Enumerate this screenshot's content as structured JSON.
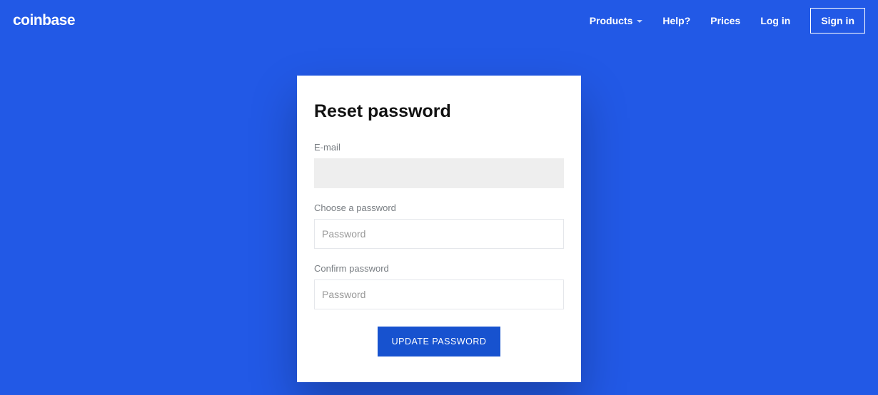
{
  "header": {
    "logo": "coinbase",
    "nav": {
      "products": "Products",
      "help": "Help?",
      "prices": "Prices",
      "login": "Log in",
      "signin": "Sign in"
    }
  },
  "form": {
    "title": "Reset password",
    "email_label": "E-mail",
    "email_value": "",
    "choose_label": "Choose a password",
    "choose_placeholder": "Password",
    "confirm_label": "Confirm password",
    "confirm_placeholder": "Password",
    "submit_label": "UPDATE PASSWORD"
  }
}
